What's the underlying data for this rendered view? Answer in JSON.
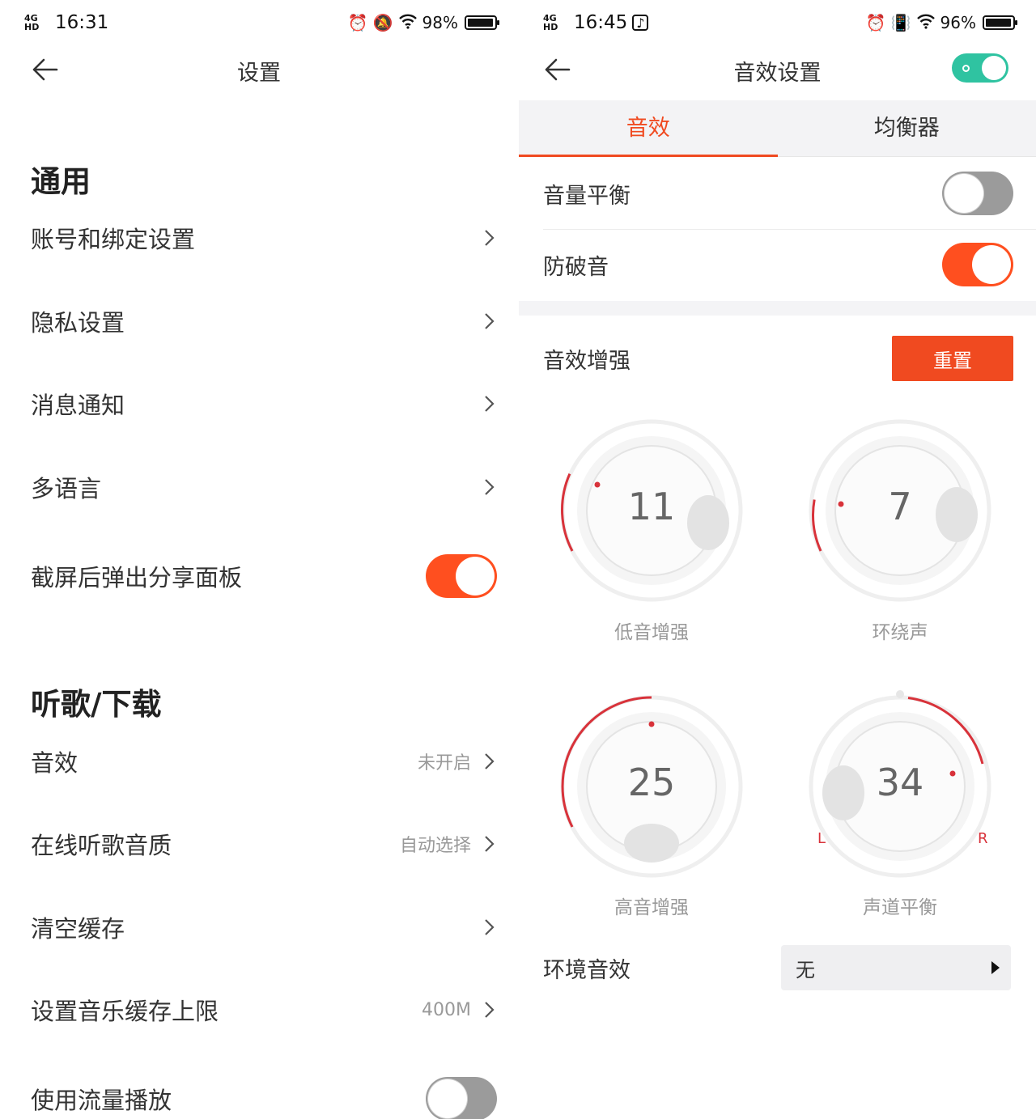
{
  "left": {
    "status": {
      "network": "4G HD",
      "time": "16:31",
      "battery": "98%",
      "battery_level": 0.98
    },
    "title": "设置",
    "sections": [
      {
        "title": "通用",
        "rows": [
          {
            "label": "账号和绑定设置",
            "value": "",
            "type": "chevron"
          },
          {
            "label": "隐私设置",
            "value": "",
            "type": "chevron"
          },
          {
            "label": "消息通知",
            "value": "",
            "type": "chevron"
          },
          {
            "label": "多语言",
            "value": "",
            "type": "chevron"
          },
          {
            "label": "截屏后弹出分享面板",
            "value": "",
            "type": "toggle",
            "on": true
          }
        ]
      },
      {
        "title": "听歌/下载",
        "rows": [
          {
            "label": "音效",
            "value": "未开启",
            "type": "chevron"
          },
          {
            "label": "在线听歌音质",
            "value": "自动选择",
            "type": "chevron"
          },
          {
            "label": "清空缓存",
            "value": "",
            "type": "chevron"
          },
          {
            "label": "设置音乐缓存上限",
            "value": "400M",
            "type": "chevron"
          },
          {
            "label": "使用流量播放",
            "value": "",
            "type": "toggle",
            "on": false
          }
        ]
      }
    ]
  },
  "right": {
    "status": {
      "network": "4G HD",
      "time": "16:45",
      "battery": "96%",
      "battery_level": 0.96
    },
    "title": "音效设置",
    "master_toggle_on": true,
    "tabs": [
      {
        "label": "音效",
        "active": true
      },
      {
        "label": "均衡器",
        "active": false
      }
    ],
    "switches": [
      {
        "label": "音量平衡",
        "on": false
      },
      {
        "label": "防破音",
        "on": true
      }
    ],
    "enhance": {
      "label": "音效增强",
      "reset_label": "重置"
    },
    "knobs": [
      {
        "label": "低音增强",
        "value": "11"
      },
      {
        "label": "环绕声",
        "value": "7"
      },
      {
        "label": "高音增强",
        "value": "25"
      },
      {
        "label": "声道平衡",
        "value": "34",
        "left_mark": "L",
        "right_mark": "R"
      }
    ],
    "ambient": {
      "label": "环境音效",
      "value": "无"
    }
  },
  "colors": {
    "accent": "#f04a20",
    "toggle_on": "#ff4f1f",
    "toggle_off": "#9b9b9b",
    "master_toggle": "#2fc3a1",
    "knob_arc": "#d8323a"
  }
}
